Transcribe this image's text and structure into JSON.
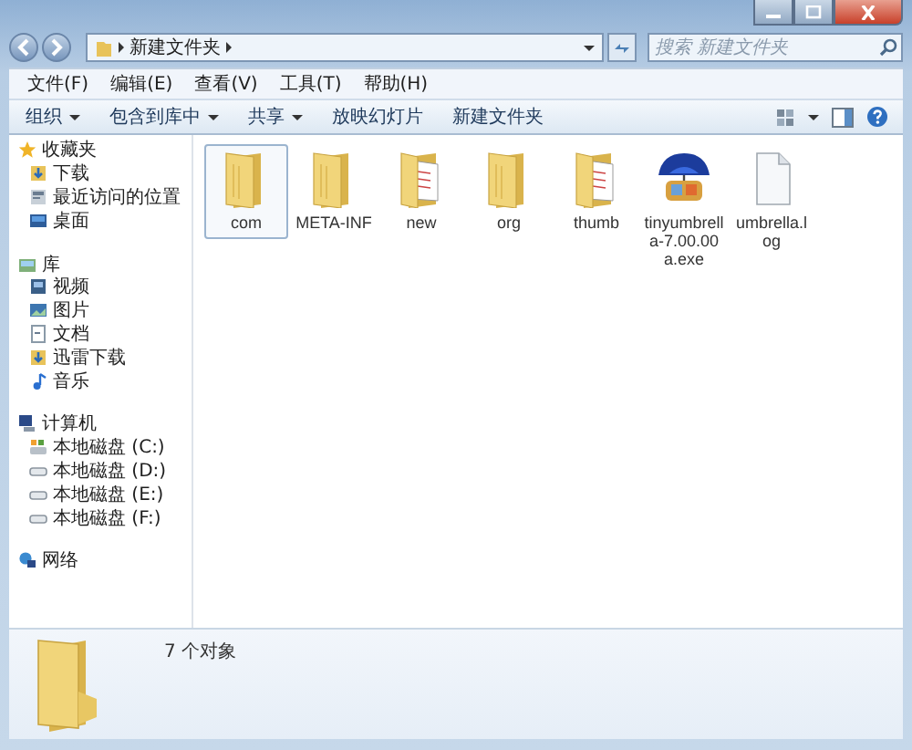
{
  "address_bar": {
    "crumbs": [
      "新建文件夹"
    ]
  },
  "search": {
    "placeholder": "搜索 新建文件夹"
  },
  "menu_bar": [
    "文件(F)",
    "编辑(E)",
    "查看(V)",
    "工具(T)",
    "帮助(H)"
  ],
  "toolbar": [
    {
      "label": "组织",
      "has_menu": true
    },
    {
      "label": "包含到库中",
      "has_menu": true
    },
    {
      "label": "共享",
      "has_menu": true
    },
    {
      "label": "放映幻灯片",
      "has_menu": false
    },
    {
      "label": "新建文件夹",
      "has_menu": false
    }
  ],
  "sidebar": {
    "sections": [
      {
        "label": "收藏夹",
        "kind": "star",
        "children": [
          {
            "label": "下载",
            "kind": "download"
          },
          {
            "label": "最近访问的位置",
            "kind": "recent"
          },
          {
            "label": "桌面",
            "kind": "desktop"
          }
        ]
      },
      {
        "label": "库",
        "kind": "library",
        "children": [
          {
            "label": "视频",
            "kind": "video"
          },
          {
            "label": "图片",
            "kind": "picture"
          },
          {
            "label": "文档",
            "kind": "document"
          },
          {
            "label": "迅雷下载",
            "kind": "download"
          },
          {
            "label": "音乐",
            "kind": "music"
          }
        ]
      },
      {
        "label": "计算机",
        "kind": "computer",
        "children": [
          {
            "label": "本地磁盘 (C:)",
            "kind": "system"
          },
          {
            "label": "本地磁盘 (D:)",
            "kind": "drive"
          },
          {
            "label": "本地磁盘 (E:)",
            "kind": "drive"
          },
          {
            "label": "本地磁盘 (F:)",
            "kind": "drive"
          }
        ]
      },
      {
        "label": "网络",
        "kind": "network"
      }
    ]
  },
  "files": [
    {
      "name": "com",
      "kind": "folder",
      "selected": true
    },
    {
      "name": "META-INF",
      "kind": "folder",
      "selected": false
    },
    {
      "name": "new",
      "kind": "folder-docs",
      "selected": false
    },
    {
      "name": "org",
      "kind": "folder",
      "selected": false
    },
    {
      "name": "thumb",
      "kind": "folder-docs",
      "selected": false
    },
    {
      "name": "tinyumbrella-7.00.00a.exe",
      "kind": "app",
      "selected": false
    },
    {
      "name": "umbrella.log",
      "kind": "document",
      "selected": false
    }
  ],
  "details_pane": {
    "summary": "7 个对象"
  }
}
